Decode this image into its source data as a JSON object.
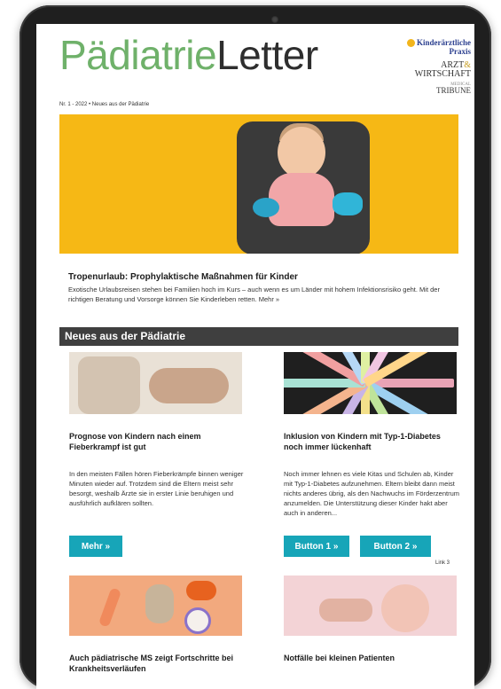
{
  "newsletter": {
    "brand_part1": "Pädiatrie",
    "brand_part2": "Letter",
    "issue_line": "Nr. 1 - 2022 • Neues aus der Pädiatrie",
    "partner_logos": {
      "logo1": "Kinderärztliche Praxis",
      "logo2_line1": "ARZT",
      "logo2_amp": "&",
      "logo2_line2": "WIRTSCHAFT",
      "logo3_small": "MEDICAL",
      "logo3": "TRIBUNE"
    }
  },
  "hero": {
    "title": "Tropenurlaub: Prophylaktische Maßnahmen für Kinder",
    "text": "Exotische Urlaubsreisen stehen bei Familien hoch im Kurs – auch wenn es um Länder mit hohem Infektionsrisiko geht. Mit der richtigen Beratung und Vorsorge können Sie Kinderleben retten. Mehr »"
  },
  "section": {
    "title": "Neues aus der Pädiatrie"
  },
  "articles": [
    {
      "title": "Prognose von Kindern nach einem Fieberkrampf ist gut",
      "text": "In den meisten Fällen hören Fieberkrämpfe binnen weniger Minuten wieder auf. Trotzdem sind die Eltern meist sehr besorgt, weshalb Ärzte sie in erster Linie beruhigen und ausführlich aufklären sollten.",
      "button": "Mehr »"
    },
    {
      "title": "Inklusion von Kindern mit Typ-1-Diabetes noch immer lückenhaft",
      "text": "Noch immer lehnen es viele Kitas und Schulen ab, Kinder mit Typ-1-Diabetes aufzunehmen. Eltern bleibt dann meist nichts anderes übrig, als den Nachwuchs im Förderzentrum anzumelden. Die Unterstützung dieser Kinder hakt aber auch in anderen...",
      "button1": "Button 1 »",
      "button2": "Button 2 »",
      "link": "Link 3"
    },
    {
      "title": "Auch pädiatrische MS zeigt Fortschritte bei Krankheitsverläufen"
    },
    {
      "title": "Notfälle bei kleinen Patienten"
    }
  ],
  "colors": {
    "brand_green": "#6fb16a",
    "hero_bg": "#f6b815",
    "section_bar": "#3f3f3f",
    "button": "#17a5b8"
  }
}
